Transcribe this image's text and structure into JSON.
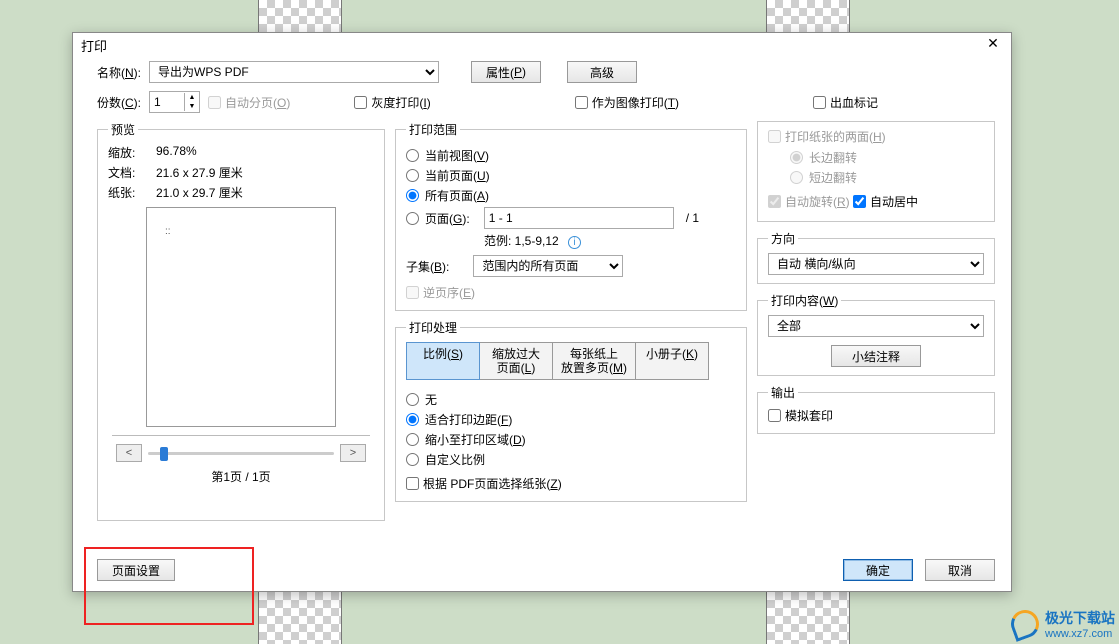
{
  "dialog": {
    "title": "打印"
  },
  "top": {
    "name_label": "名称(N):",
    "printer": "导出为WPS PDF",
    "props_btn": "属性(P)",
    "adv_btn": "高级",
    "copies_label": "份数(C):",
    "copies_value": "1",
    "collate": "自动分页(O)",
    "grayscale": "灰度打印(I)",
    "as_image": "作为图像打印(T)",
    "bleed": "出血标记"
  },
  "preview": {
    "legend": "预览",
    "zoom_label": "缩放:",
    "zoom_value": "96.78%",
    "doc_label": "文档:",
    "doc_value": "21.6 x 27.9 厘米",
    "paper_label": "纸张:",
    "paper_value": "21.0 x 29.7 厘米",
    "page_status": "第1页 / 1页",
    "thumb_text": "::"
  },
  "range": {
    "legend": "打印范围",
    "current_view": "当前视图(V)",
    "current_page": "当前页面(U)",
    "all_pages": "所有页面(A)",
    "pages": "页面(G):",
    "pages_value": "1 - 1",
    "total_suffix": "/ 1",
    "example": "范例: 1,5-9,12",
    "subset_label": "子集(B):",
    "subset_value": "范围内的所有页面",
    "reverse": "逆页序(E)"
  },
  "handling": {
    "legend": "打印处理",
    "tab_scale": "比例(S)",
    "tab_large": "缩放过大\n页面(L)",
    "tab_multi": "每张纸上\n放置多页(M)",
    "tab_booklet": "小册子(K)",
    "opt_none": "无",
    "opt_fit": "适合打印边距(F)",
    "opt_shrink": "缩小至打印区域(D)",
    "opt_custom": "自定义比例",
    "choose_by_pdf": "根据 PDF页面选择纸张(Z)"
  },
  "right": {
    "duplex": "打印纸张的两面(H)",
    "long_edge": "长边翻转",
    "short_edge": "短边翻转",
    "auto_rotate": "自动旋转(R)",
    "auto_center": "自动居中",
    "orient_legend": "方向",
    "orient_value": "自动 横向/纵向",
    "content_legend": "打印内容(W)",
    "content_value": "全部",
    "summary_btn": "小结注释",
    "output_legend": "输出",
    "simulate": "模拟套印"
  },
  "footer": {
    "page_setup": "页面设置",
    "ok": "确定",
    "cancel": "取消"
  },
  "watermark": {
    "line1": "极光下载站",
    "line2": "www.xz7.com"
  }
}
